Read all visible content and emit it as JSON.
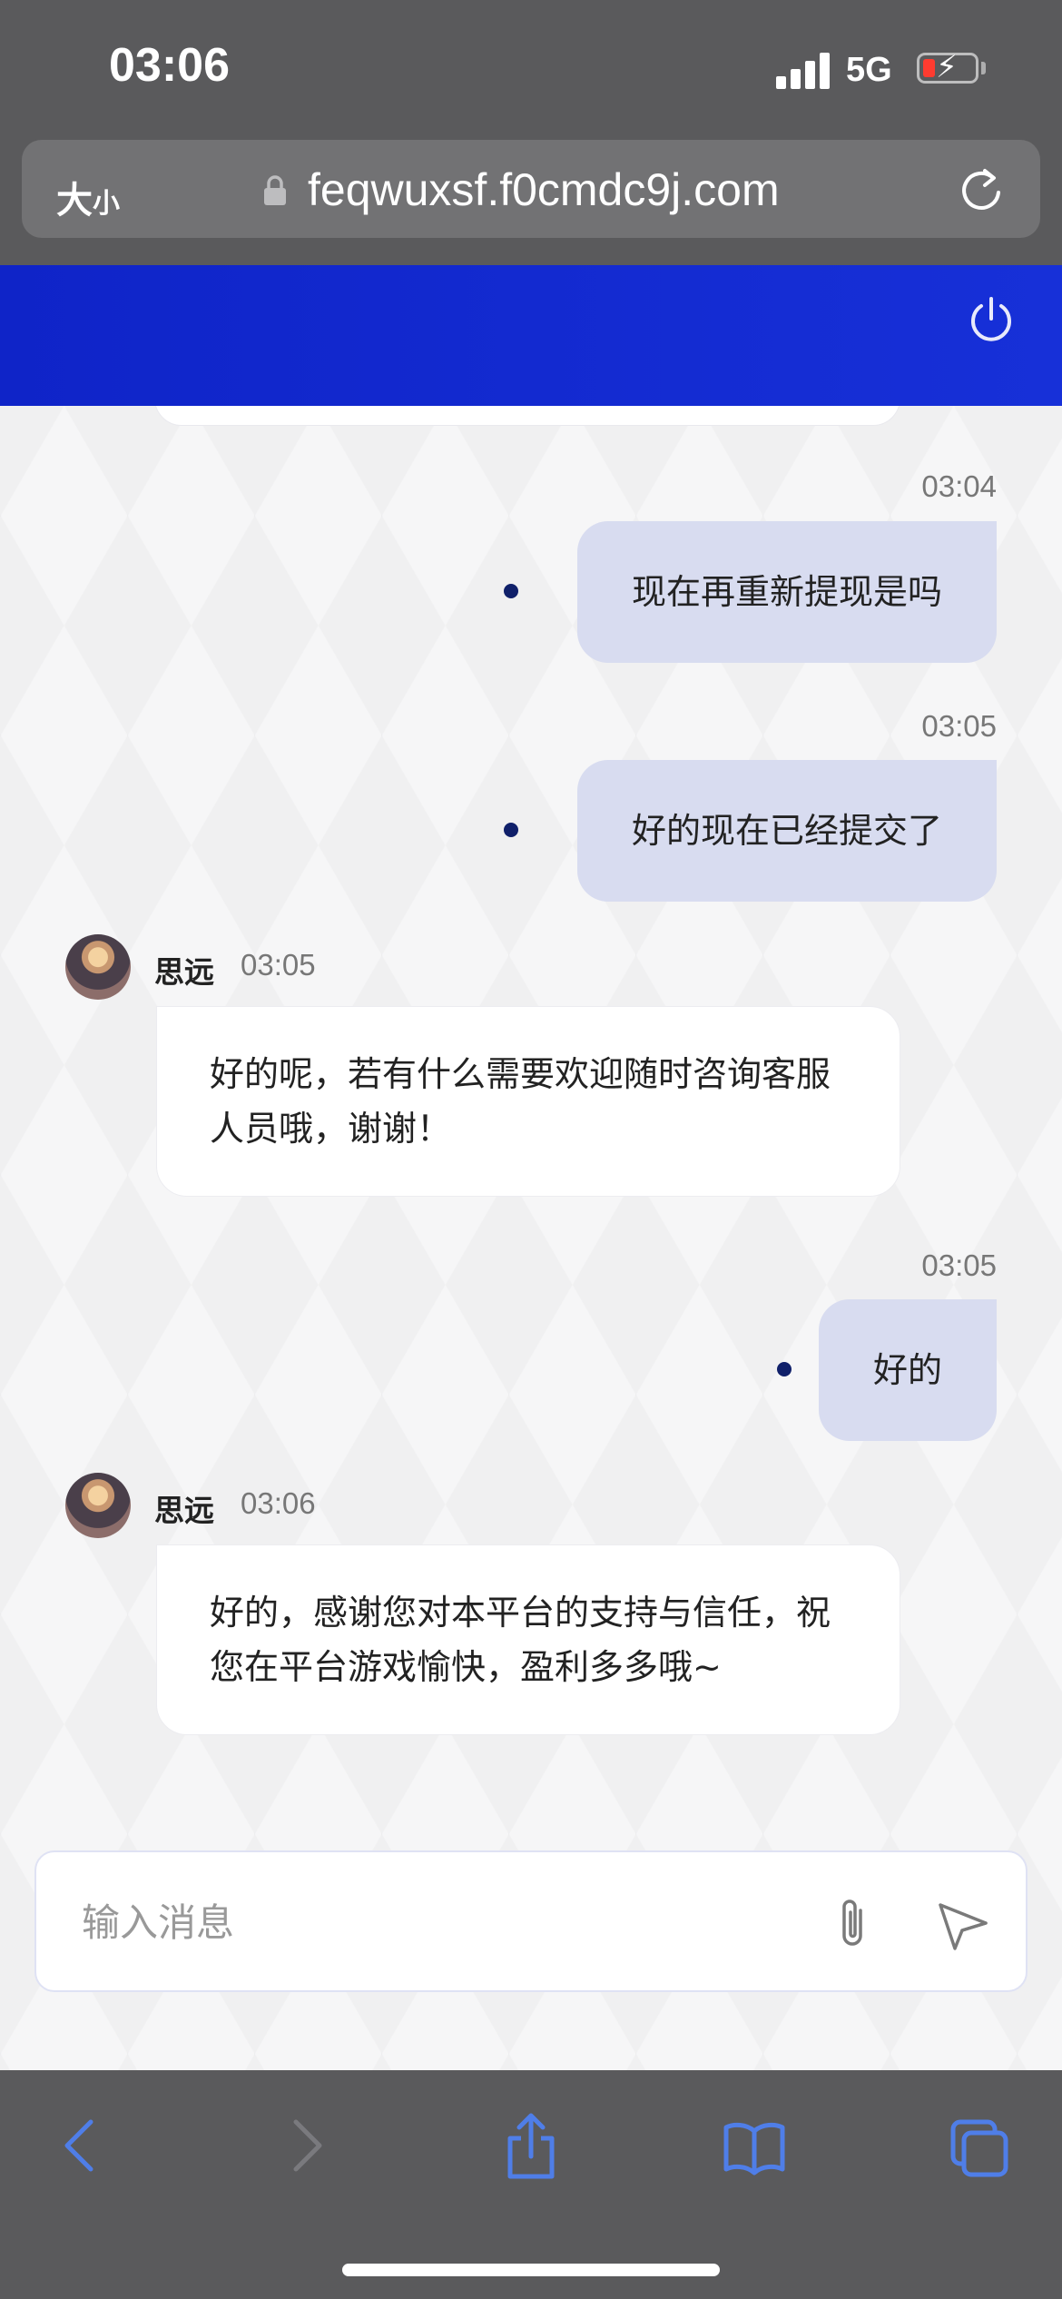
{
  "status_bar": {
    "time": "03:06",
    "network": "5G",
    "battery_level": 0.2,
    "charging": true
  },
  "browser": {
    "text_size_label_big": "大",
    "text_size_label_small": "小",
    "url": "feqwuxsf.f0cmdc9j.com"
  },
  "chat": {
    "header_color": "#1329cf",
    "messages": [
      {
        "direction": "out",
        "time": "03:04",
        "text": "现在再重新提现是吗"
      },
      {
        "direction": "out",
        "time": "03:05",
        "text": "好的现在已经提交了"
      },
      {
        "direction": "in",
        "sender": "思远",
        "time": "03:05",
        "text": "好的呢，若有什么需要欢迎随时咨询客服人员哦，谢谢！"
      },
      {
        "direction": "out",
        "time": "03:05",
        "text": "好的"
      },
      {
        "direction": "in",
        "sender": "思远",
        "time": "03:06",
        "text": "好的，感谢您对本平台的支持与信任，祝您在平台游戏愉快，盈利多多哦~"
      }
    ]
  },
  "composer": {
    "placeholder": "输入消息",
    "value": ""
  },
  "toolbar": {
    "icons": [
      "back-icon",
      "forward-icon",
      "share-icon",
      "bookmarks-icon",
      "tabs-icon"
    ],
    "accent": "#4f7ee8"
  }
}
